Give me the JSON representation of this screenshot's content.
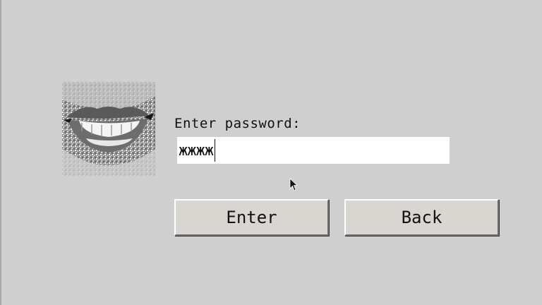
{
  "login": {
    "prompt_label": "Enter password:",
    "password_value": "жжжж"
  },
  "buttons": {
    "enter_label": "Enter",
    "back_label": "Back"
  },
  "avatar": {
    "icon": "lips-smile-photo-icon"
  },
  "colors": {
    "background": "#cfcfcf",
    "field_background": "#ffffff",
    "button_face": "#d9d6d2"
  }
}
